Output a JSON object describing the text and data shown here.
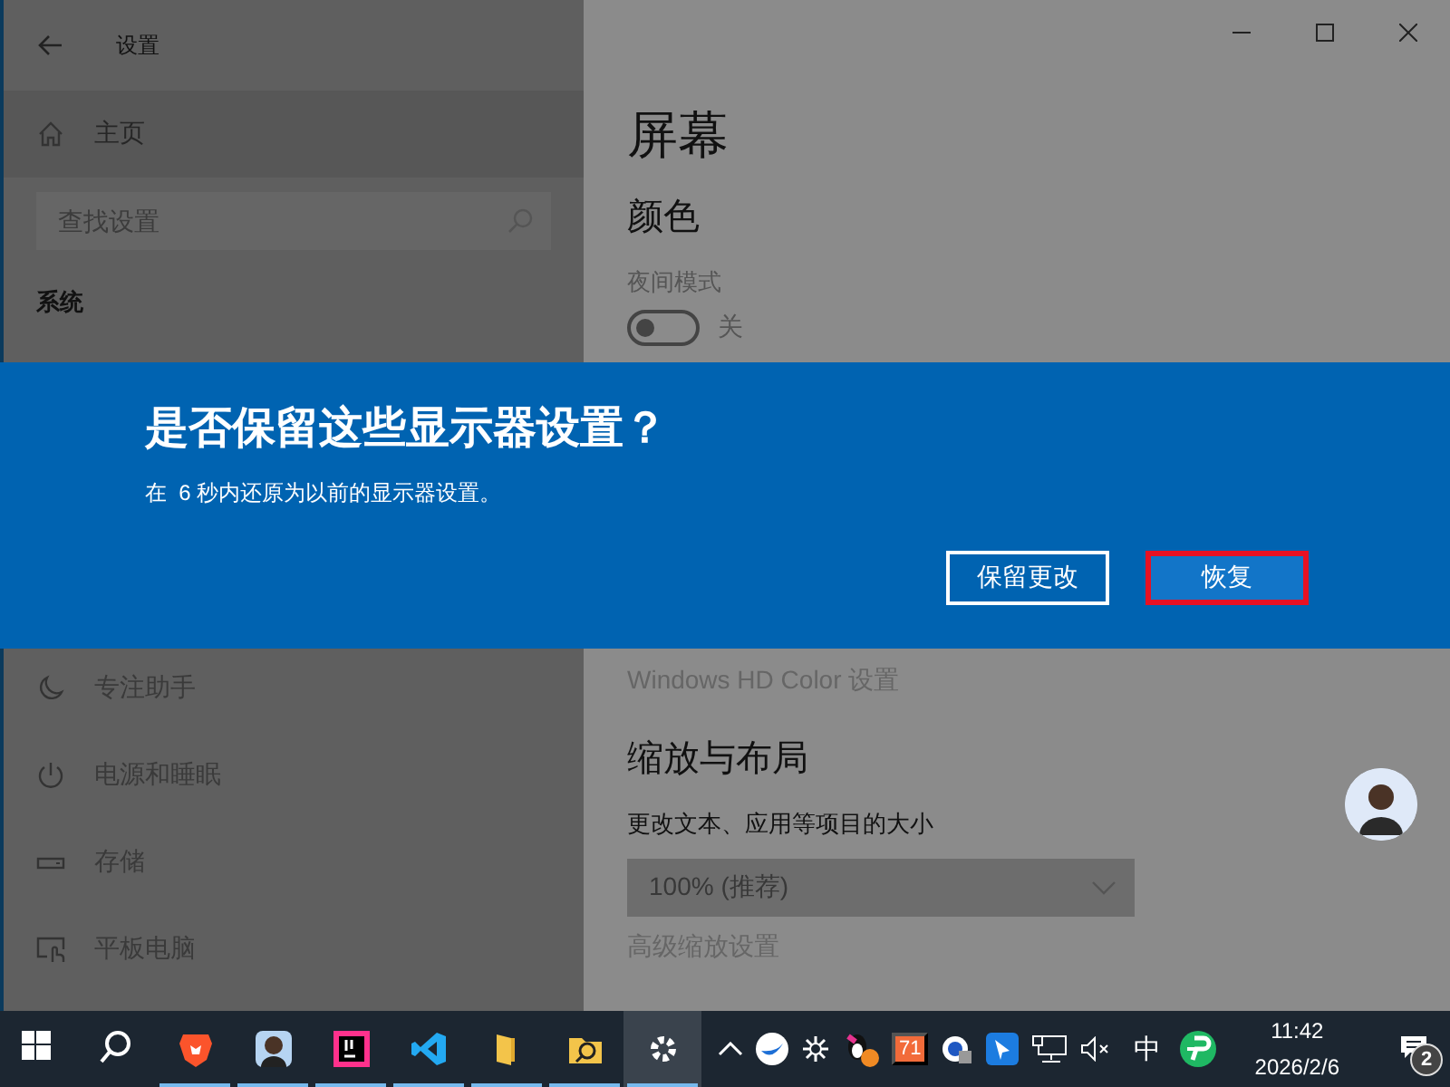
{
  "window": {
    "title": "设置"
  },
  "sidebar": {
    "home": "主页",
    "search": {
      "placeholder": "查找设置"
    },
    "section": "系统",
    "items": [
      {
        "label": "专注助手"
      },
      {
        "label": "电源和睡眠"
      },
      {
        "label": "存储"
      },
      {
        "label": "平板电脑"
      }
    ]
  },
  "content": {
    "title": "屏幕",
    "color_heading": "颜色",
    "night_mode_label": "夜间模式",
    "night_mode": {
      "on": false,
      "label": "关"
    },
    "hd_link": "Windows HD Color 设置",
    "scale_heading": "缩放与布局",
    "scale_label": "更改文本、应用等项目的大小",
    "scale_dropdown": {
      "value": "100% (推荐)"
    },
    "advanced_link": "高级缩放设置"
  },
  "dialog": {
    "title": "是否保留这些显示器设置？",
    "message": "在  6 秒内还原为以前的显示器设置。",
    "buttons": [
      {
        "label": "保留更改",
        "highlighted": false
      },
      {
        "label": "恢复",
        "highlighted": true
      }
    ]
  },
  "taskbar": {
    "apps": [
      {
        "running": false,
        "selected": false
      },
      {
        "running": false,
        "selected": false
      },
      {
        "running": true,
        "selected": false
      },
      {
        "running": true,
        "selected": false
      },
      {
        "running": true,
        "selected": false
      },
      {
        "running": true,
        "selected": false
      },
      {
        "running": true,
        "selected": false
      },
      {
        "running": true,
        "selected": false
      },
      {
        "running": true,
        "selected": true
      }
    ],
    "tray_badge": "71",
    "ime": "中",
    "time": "11:42",
    "date": "2026/2/6",
    "notifications": "2"
  }
}
